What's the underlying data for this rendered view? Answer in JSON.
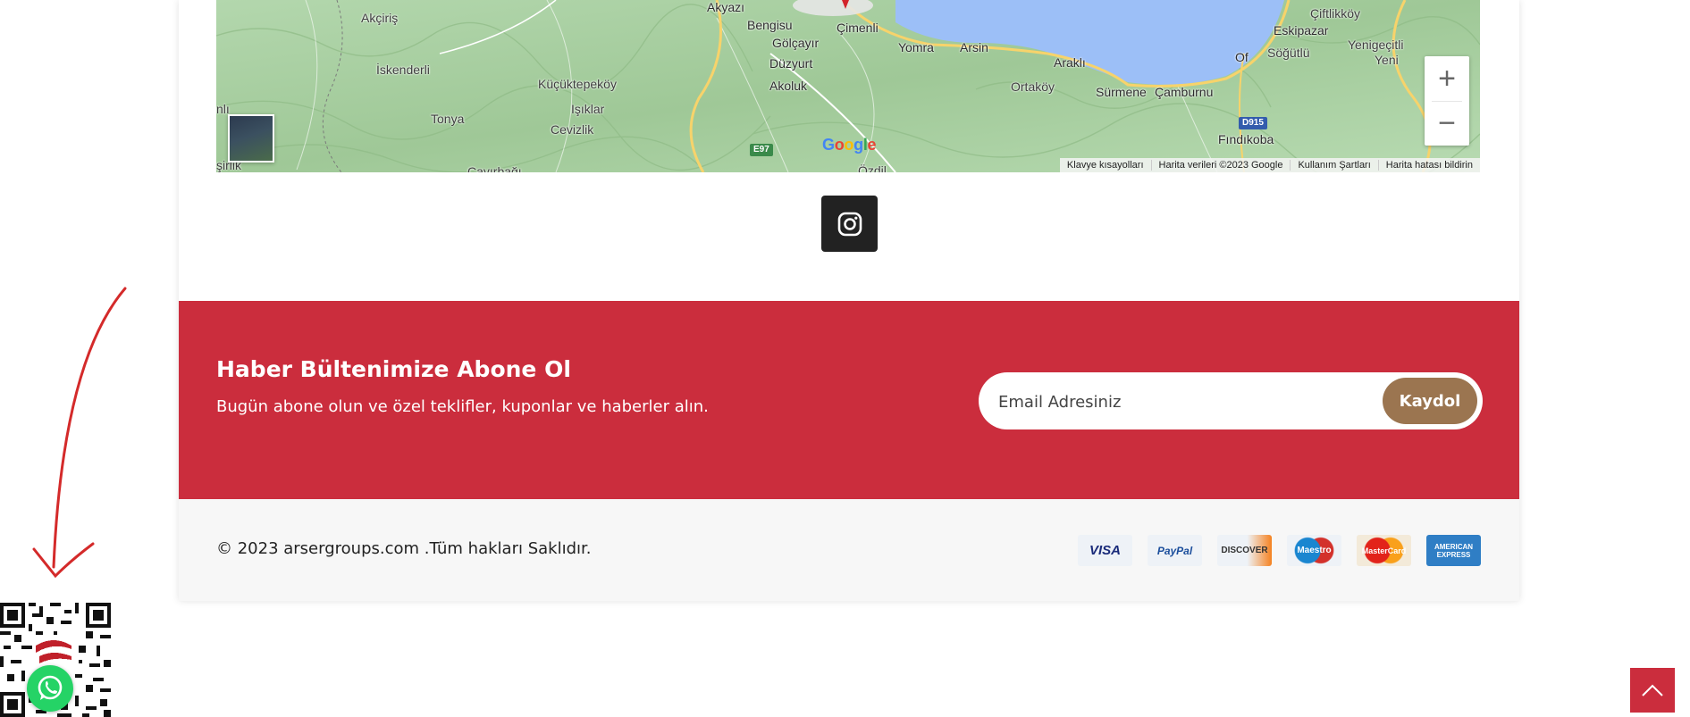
{
  "map": {
    "places": [
      {
        "name": "Akçiriş"
      },
      {
        "name": "İskenderli"
      },
      {
        "name": "Tonya"
      },
      {
        "name": "Küçüktepeköy"
      },
      {
        "name": "Işıklar"
      },
      {
        "name": "Cevizlik"
      },
      {
        "name": "Akyazı"
      },
      {
        "name": "Bengisu"
      },
      {
        "name": "Gölçayır"
      },
      {
        "name": "Düzyurt"
      },
      {
        "name": "Akoluk"
      },
      {
        "name": "Çimenli"
      },
      {
        "name": "Yomra"
      },
      {
        "name": "Arsin"
      },
      {
        "name": "Araklı"
      },
      {
        "name": "Ortaköy"
      },
      {
        "name": "Sürmene"
      },
      {
        "name": "Çamburnu"
      },
      {
        "name": "Of"
      },
      {
        "name": "Eskipazar"
      },
      {
        "name": "Söğütlü"
      },
      {
        "name": "Çiftlikköy"
      },
      {
        "name": "Yenigeçitli"
      },
      {
        "name": "Yeni"
      },
      {
        "name": "Fındıkoba"
      },
      {
        "name": "Özdil"
      },
      {
        "name": "Çayırbağı"
      },
      {
        "name": "nlı"
      },
      {
        "name": "şirlik"
      }
    ],
    "roads": [
      "E97",
      "D915"
    ],
    "zoom_in_label": "+",
    "zoom_out_label": "−",
    "logo": "Google",
    "attribution": [
      "Klavye kısayolları",
      "Harita verileri ©2023 Google",
      "Kullanım Şartları",
      "Harita hatası bildirin"
    ]
  },
  "social": {
    "icon": "instagram-icon"
  },
  "newsletter": {
    "title": "Haber Bültenimize Abone Ol",
    "subtitle": "Bugün abone olun ve özel teklifler, kuponlar ve haberler alın.",
    "email_placeholder": "Email Adresiniz",
    "submit_label": "Kaydol",
    "bg_color": "#cb2d3d",
    "button_color": "#9b7550"
  },
  "footer": {
    "copyright": "© 2023 arsergroups.com .Tüm hakları Saklıdır.",
    "payments": [
      "VISA",
      "PayPal",
      "DISCOVER",
      "Maestro",
      "MasterCard",
      "AMERICAN EXPRESS"
    ]
  },
  "floating": {
    "whatsapp_icon": "whatsapp-icon",
    "scroll_icon": "chevron-up-icon",
    "accent_color": "#cb2d3d"
  }
}
